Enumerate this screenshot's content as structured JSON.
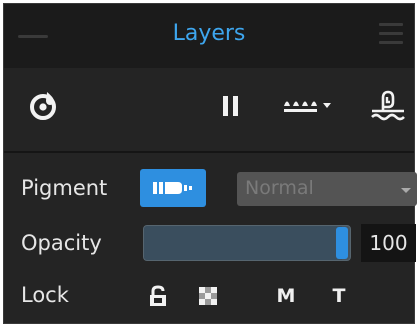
{
  "panel": {
    "title": "Layers"
  },
  "toolbar": {
    "icons": [
      "record-icon",
      "pause-icon",
      "layer-options-icon",
      "trace-icon"
    ]
  },
  "pigment": {
    "label": "Pigment",
    "blend_mode": "Normal"
  },
  "opacity": {
    "label": "Opacity",
    "value": "100",
    "level": 1.0
  },
  "lock": {
    "label": "Lock",
    "m_label": "M",
    "t_label": "T"
  },
  "colors": {
    "accent": "#2e8fe0",
    "title": "#3ea6ee",
    "panel_bg": "#242424"
  }
}
